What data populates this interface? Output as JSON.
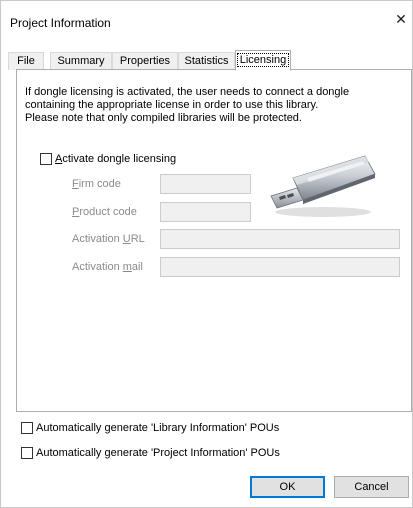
{
  "window": {
    "title": "Project Information",
    "close_glyph": "✕"
  },
  "tabs": [
    {
      "label": "File",
      "active": false
    },
    {
      "label": "Summary",
      "active": false
    },
    {
      "label": "Properties",
      "active": false
    },
    {
      "label": "Statistics",
      "active": false
    },
    {
      "label": "Licensing",
      "active": true
    }
  ],
  "licensing": {
    "info_lines": [
      "If dongle licensing is activated, the user needs to connect a dongle",
      "containing the appropriate license in order to use this library.",
      "Please note that only compiled libraries will be protected."
    ],
    "activate_checkbox": {
      "hotkey": "A",
      "rest": "ctivate dongle licensing",
      "checked": false
    },
    "fields": [
      {
        "key": "firm_code",
        "pre": "",
        "hotkey": "F",
        "post": "irm code",
        "value": ""
      },
      {
        "key": "product_code",
        "pre": "",
        "hotkey": "P",
        "post": "roduct code",
        "value": ""
      },
      {
        "key": "activation_url",
        "pre": "Activation ",
        "hotkey": "U",
        "post": "RL",
        "value": ""
      },
      {
        "key": "activation_mail",
        "pre": "Activation ",
        "hotkey": "m",
        "post": "ail",
        "value": ""
      }
    ],
    "dongle_icon": "usb-dongle-icon"
  },
  "options": {
    "gen_library_info": {
      "label": "Automatically generate 'Library Information' POUs",
      "checked": false
    },
    "gen_project_info": {
      "label": "Automatically generate 'Project Information' POUs",
      "checked": false
    }
  },
  "buttons": {
    "ok": "OK",
    "cancel": "Cancel"
  },
  "colors": {
    "default_button_border": "#0078d7",
    "disabled_text": "#8a8a8a",
    "disabled_field": "#f0f0f0"
  }
}
